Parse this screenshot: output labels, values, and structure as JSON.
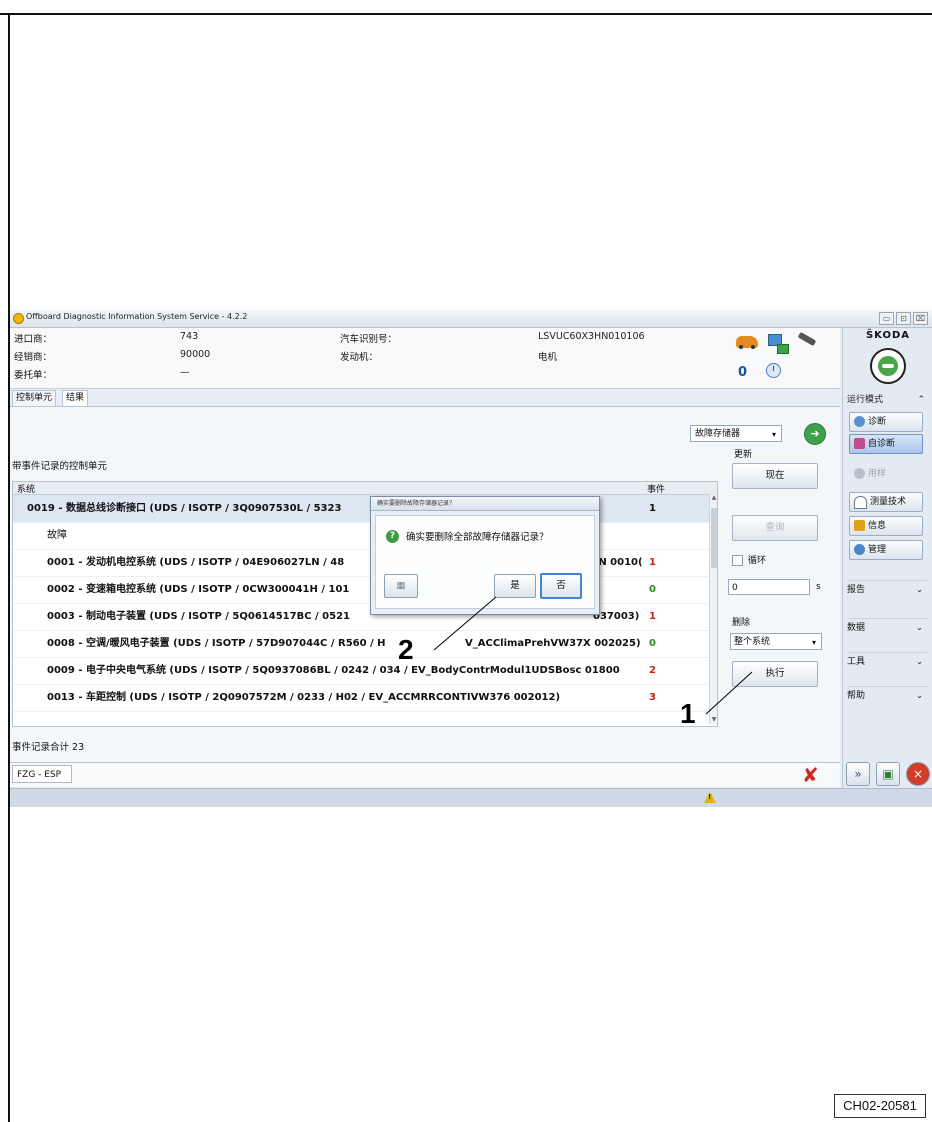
{
  "window": {
    "title": "Offboard Diagnostic Information System Service - 4.2.2",
    "controls": [
      "▭",
      "⊡",
      "⌧"
    ]
  },
  "vehicle_info": {
    "importer_label": "进口商：",
    "importer_value": "743",
    "dealer_label": "经销商：",
    "dealer_value": "90000",
    "order_label": "委托单：",
    "order_value": "—",
    "vin_label": "汽车识别号：",
    "vin_value": "LSVUC60X3HN010106",
    "engine_label": "发动机：",
    "engine_value": "电机"
  },
  "status_icons": {
    "counter": "0"
  },
  "brand": {
    "name": "ŠKODA"
  },
  "right_panel": {
    "mode_header": "运行模式",
    "mode_chevron": "⌃",
    "modes": [
      {
        "label": "诊断",
        "state": "normal"
      },
      {
        "label": "自诊断",
        "state": "active"
      },
      {
        "label": "用样",
        "state": "disabled"
      },
      {
        "label": "测量技术",
        "state": "normal"
      },
      {
        "label": "信息",
        "state": "normal"
      },
      {
        "label": "管理",
        "state": "normal"
      }
    ],
    "sections": [
      "报告",
      "数据",
      "工具",
      "帮助"
    ],
    "section_chevron": "⌄"
  },
  "tabs": [
    "控制单元",
    "结果"
  ],
  "main": {
    "memory_select": "故障存储器",
    "select_arrow": "▾",
    "go_symbol": "➜",
    "list_label": "带事件记录的控制单元",
    "table_header_system": "系统",
    "table_header_events": "事件",
    "rows": [
      {
        "text": "0019 - 数据总线诊断接口 (UDS / ISOTP / 3Q0907530L / 5323",
        "events": "1",
        "color": "#111111"
      },
      {
        "text": "故障",
        "events": "",
        "color": "#111111"
      },
      {
        "text": "0001 - 发动机电控系统 (UDS / ISOTP / 04E906027LN / 48",
        "events": "1",
        "tail": "7LN 0010(",
        "color": "#d0201a"
      },
      {
        "text": "0002 - 变速箱电控系统 (UDS / ISOTP / 0CW300041H / 101",
        "events": "0",
        "color": "#2a8a2a"
      },
      {
        "text": "0003 - 制动电子装置 (UDS / ISOTP / 5Q0614517BC / 0521",
        "events": "1",
        "tail": "037003)",
        "color": "#d0201a"
      },
      {
        "text": "0008 - 空调/暖风电子装置 (UDS / ISOTP / 57D907044C / R560 / H",
        "events": "0",
        "tail": "V_ACClimaPrehVW37X 002025)",
        "color": "#2a8a2a"
      },
      {
        "text": "0009 - 电子中央电气系统 (UDS / ISOTP / 5Q0937086BL / 0242 / 034 / EV_BodyContrModul1UDSBosc 01800",
        "events": "2",
        "color": "#d0201a"
      },
      {
        "text": "0013 - 车距控制 (UDS / ISOTP / 2Q0907572M / 0233 / H02 / EV_ACCMRRCONTIVW376 002012)",
        "events": "3",
        "color": "#d0201a"
      }
    ],
    "update_label": "更新",
    "now_button": "现在",
    "query_button": "查询",
    "loop_label": "循环",
    "interval_value": "0",
    "interval_unit": "s",
    "delete_label": "删除",
    "scope_select": "整个系统",
    "execute_button": "执行",
    "event_total": "事件记录合计 23",
    "status_field": "FZG - ESP",
    "close_symbol": "✘"
  },
  "dialog": {
    "title": "确实要删除故障存储器记录？",
    "icon_glyph": "?",
    "message": "确实要删除全部故障存储器记录？",
    "yes_button": "是",
    "no_button": "否"
  },
  "callouts": [
    "1",
    "2"
  ],
  "figure_code": "CH02-20581",
  "colors": {
    "accent_green": "#3fa24a",
    "error_red": "#d0201a",
    "ok_green": "#2a8a2a",
    "selection_blue": "#a9c6ea"
  }
}
